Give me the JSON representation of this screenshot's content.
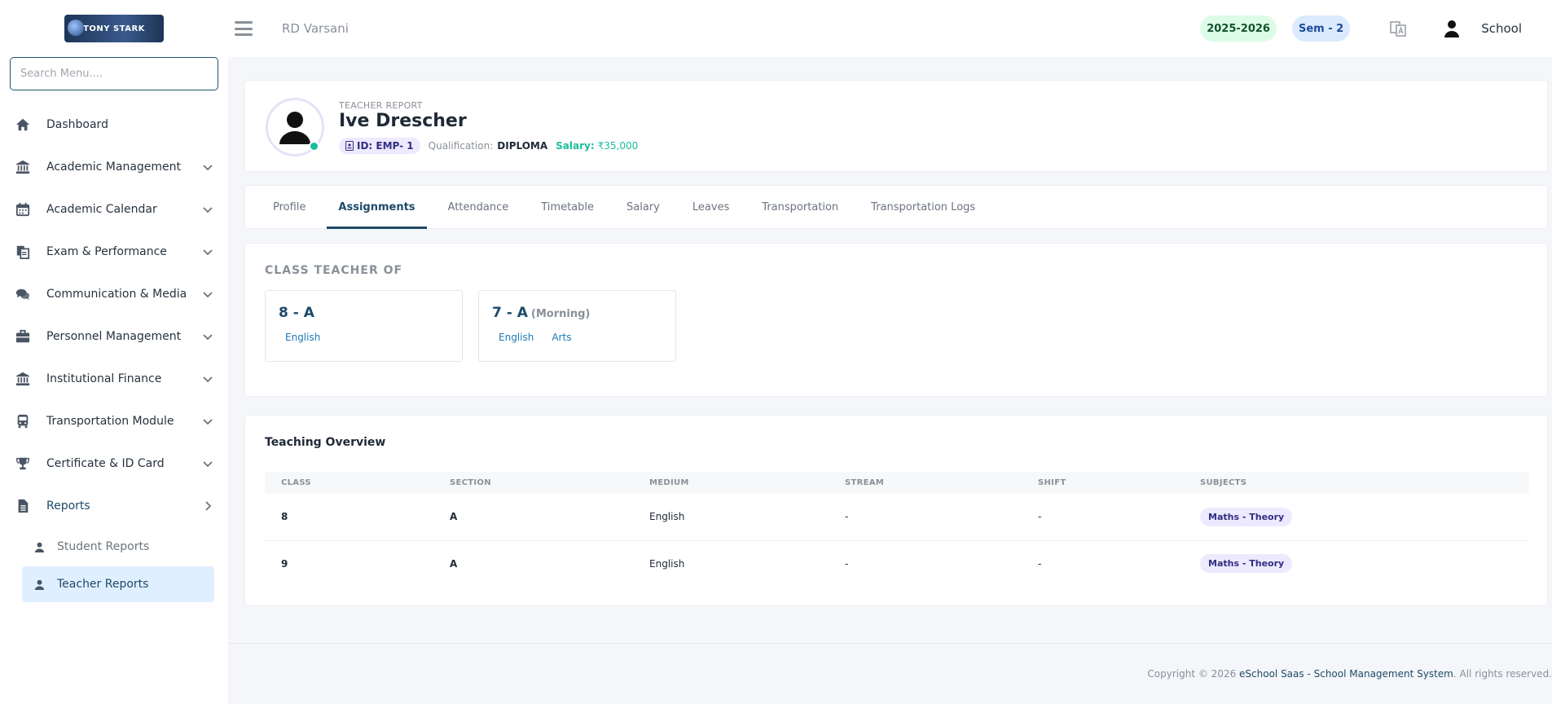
{
  "brand": {
    "logo_text": "TONY STARK"
  },
  "search": {
    "placeholder": "Search Menu...."
  },
  "sidebar": {
    "items": [
      {
        "label": "Dashboard",
        "icon": "home-icon"
      },
      {
        "label": "Academic Management",
        "icon": "bank-icon"
      },
      {
        "label": "Academic Calendar",
        "icon": "calendar-icon"
      },
      {
        "label": "Exam & Performance",
        "icon": "documents-icon"
      },
      {
        "label": "Communication & Media",
        "icon": "comments-icon"
      },
      {
        "label": "Personnel Management",
        "icon": "briefcase-icon"
      },
      {
        "label": "Institutional Finance",
        "icon": "bank-icon"
      },
      {
        "label": "Transportation Module",
        "icon": "bus-icon"
      },
      {
        "label": "Certificate & ID Card",
        "icon": "trophy-icon"
      },
      {
        "label": "Reports",
        "icon": "file-icon"
      }
    ],
    "reports_sub": [
      {
        "label": "Student Reports",
        "icon": "user-icon"
      },
      {
        "label": "Teacher Reports",
        "icon": "user-icon"
      }
    ]
  },
  "header": {
    "school": "RD Varsani",
    "year": "2025-2026",
    "semester": "Sem - 2",
    "user": "School"
  },
  "profile": {
    "report_label": "TEACHER REPORT",
    "name": "Ive Drescher",
    "id": "ID: EMP- 1",
    "qualification_label": "Qualification:",
    "qualification": "DIPLOMA",
    "salary_label": "Salary:",
    "salary": "₹35,000"
  },
  "tabs": [
    "Profile",
    "Assignments",
    "Attendance",
    "Timetable",
    "Salary",
    "Leaves",
    "Transportation",
    "Transportation Logs"
  ],
  "class_teacher": {
    "title": "CLASS TEACHER OF",
    "classes": [
      {
        "name": "8 - A",
        "shift": "",
        "subjects": [
          "English"
        ]
      },
      {
        "name": "7 - A",
        "shift": "(Morning)",
        "subjects": [
          "English",
          "Arts"
        ]
      }
    ]
  },
  "overview": {
    "title": "Teaching Overview",
    "columns": [
      "CLASS",
      "SECTION",
      "MEDIUM",
      "STREAM",
      "SHIFT",
      "SUBJECTS"
    ],
    "rows": [
      {
        "class": "8",
        "section": "A",
        "medium": "English",
        "stream": "-",
        "shift": "-",
        "subject": "Maths - Theory"
      },
      {
        "class": "9",
        "section": "A",
        "medium": "English",
        "stream": "-",
        "shift": "-",
        "subject": "Maths - Theory"
      }
    ]
  },
  "footer": {
    "prefix": "Copyright © 2026 ",
    "brand": "eSchool Saas - School Management System",
    "suffix": ". All rights reserved."
  },
  "colors": {
    "accent": "#1e4a68",
    "success": "#1abc9c",
    "active_bg": "#e0efff"
  }
}
